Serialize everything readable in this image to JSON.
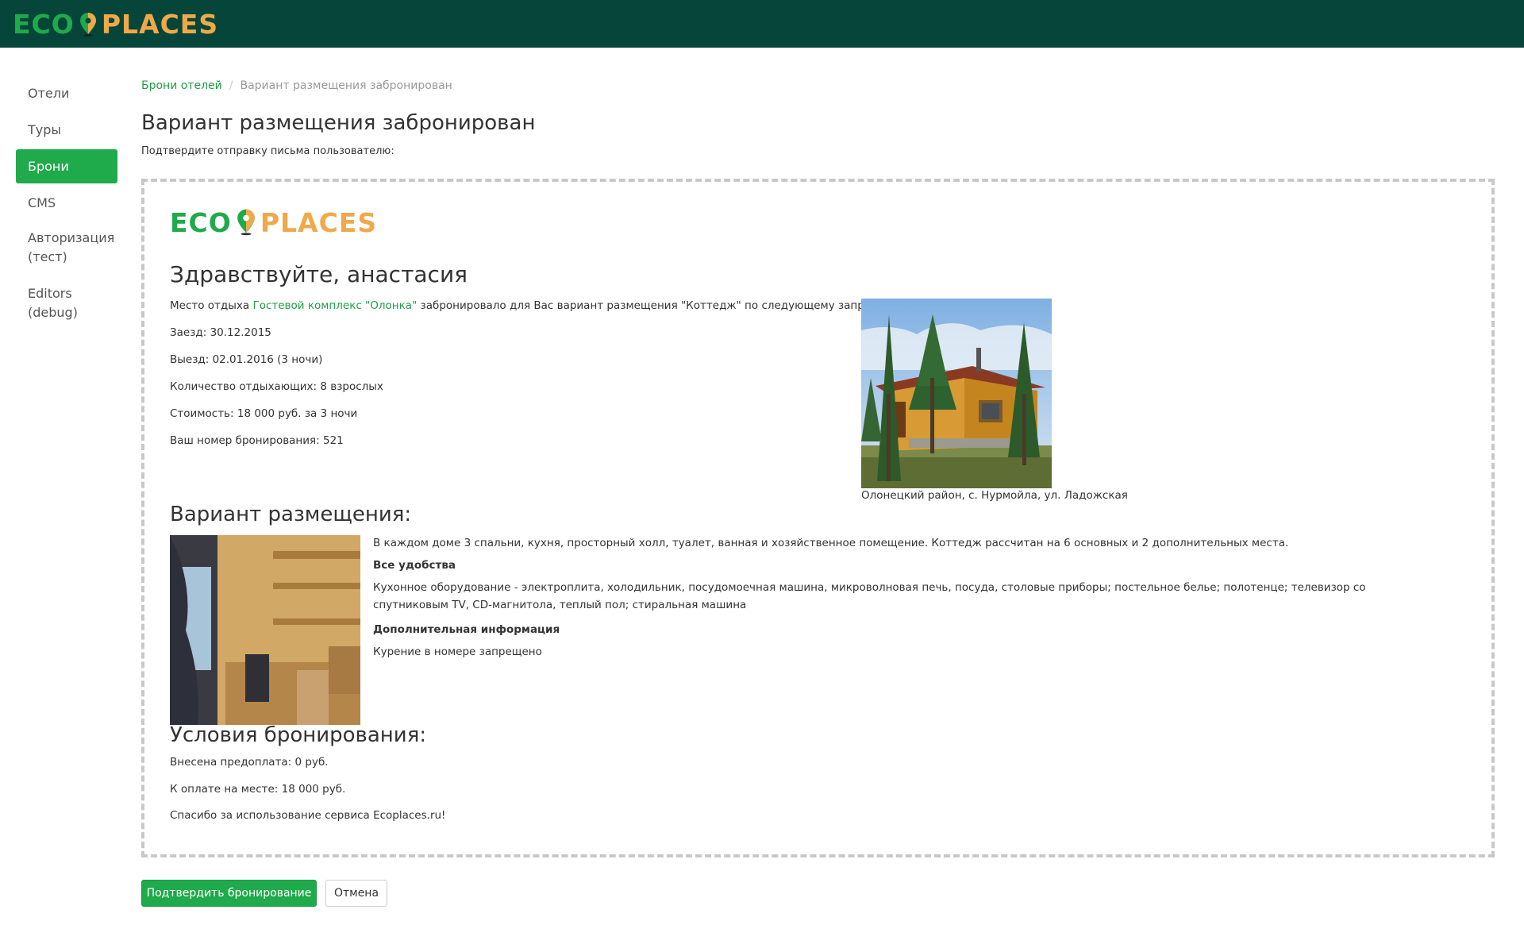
{
  "brand": {
    "eco": "ECO",
    "places": "PLACES"
  },
  "sidebar": {
    "items": [
      {
        "label": "Отели"
      },
      {
        "label": "Туры"
      },
      {
        "label": "Брони"
      },
      {
        "label": "CMS"
      },
      {
        "label": "Авторизация (тест)"
      },
      {
        "label": "Editors (debug)"
      }
    ],
    "active_index": 2
  },
  "breadcrumb": {
    "parent": "Брони отелей",
    "current": "Вариант размещения забронирован"
  },
  "page": {
    "title": "Вариант размещения забронирован",
    "subtitle": "Подтвердите отправку письма пользователю:"
  },
  "email": {
    "greeting": "Здравствуйте, анастасия",
    "intro_before": "Место отдыха ",
    "intro_link": "Гостевой комплекс \"Олонка\"",
    "intro_after": " забронировало для Вас вариант размещения \"Коттедж\" по следующему запросу:",
    "details": [
      "Заезд: 30.12.2015",
      "Выезд: 02.01.2016 (3 ночи)",
      "Количество отдыхающих: 8 взрослых",
      "Стоимость: 18 000 руб. за 3 ночи",
      "Ваш номер бронирования: 521"
    ],
    "photo_caption": "Олонецкий район, с. Нурмойла, ул. Ладожская",
    "variant_heading": "Вариант размещения:",
    "variant_description": "В каждом доме 3 спальни, кухня, просторный холл, туалет, ванная и хозяйственное помещение. Коттедж рассчитан на 6 основных и 2 дополнительных места.",
    "amenities_heading": "Все удобства",
    "amenities_text": "Кухонное оборудование - электроплита, холодильник, посудомоечная машина, микроволновая печь, посуда, столовые приборы; постельное белье; полотенце; телевизор со спутниковым TV, CD-магнитола, теплый пол; стиральная машина",
    "extra_heading": "Дополнительная информация",
    "extra_text": "Курение в номере запрещено",
    "conditions_heading": "Условия бронирования:",
    "prepayment": "Внесена предоплата: 0 руб.",
    "on_site": "К оплате на месте: 18 000 руб.",
    "thanks": "Спасибо за использование сервиса Ecoplaces.ru!"
  },
  "actions": {
    "confirm_label": "Подтвердить бронирование",
    "cancel_label": "Отмена"
  }
}
